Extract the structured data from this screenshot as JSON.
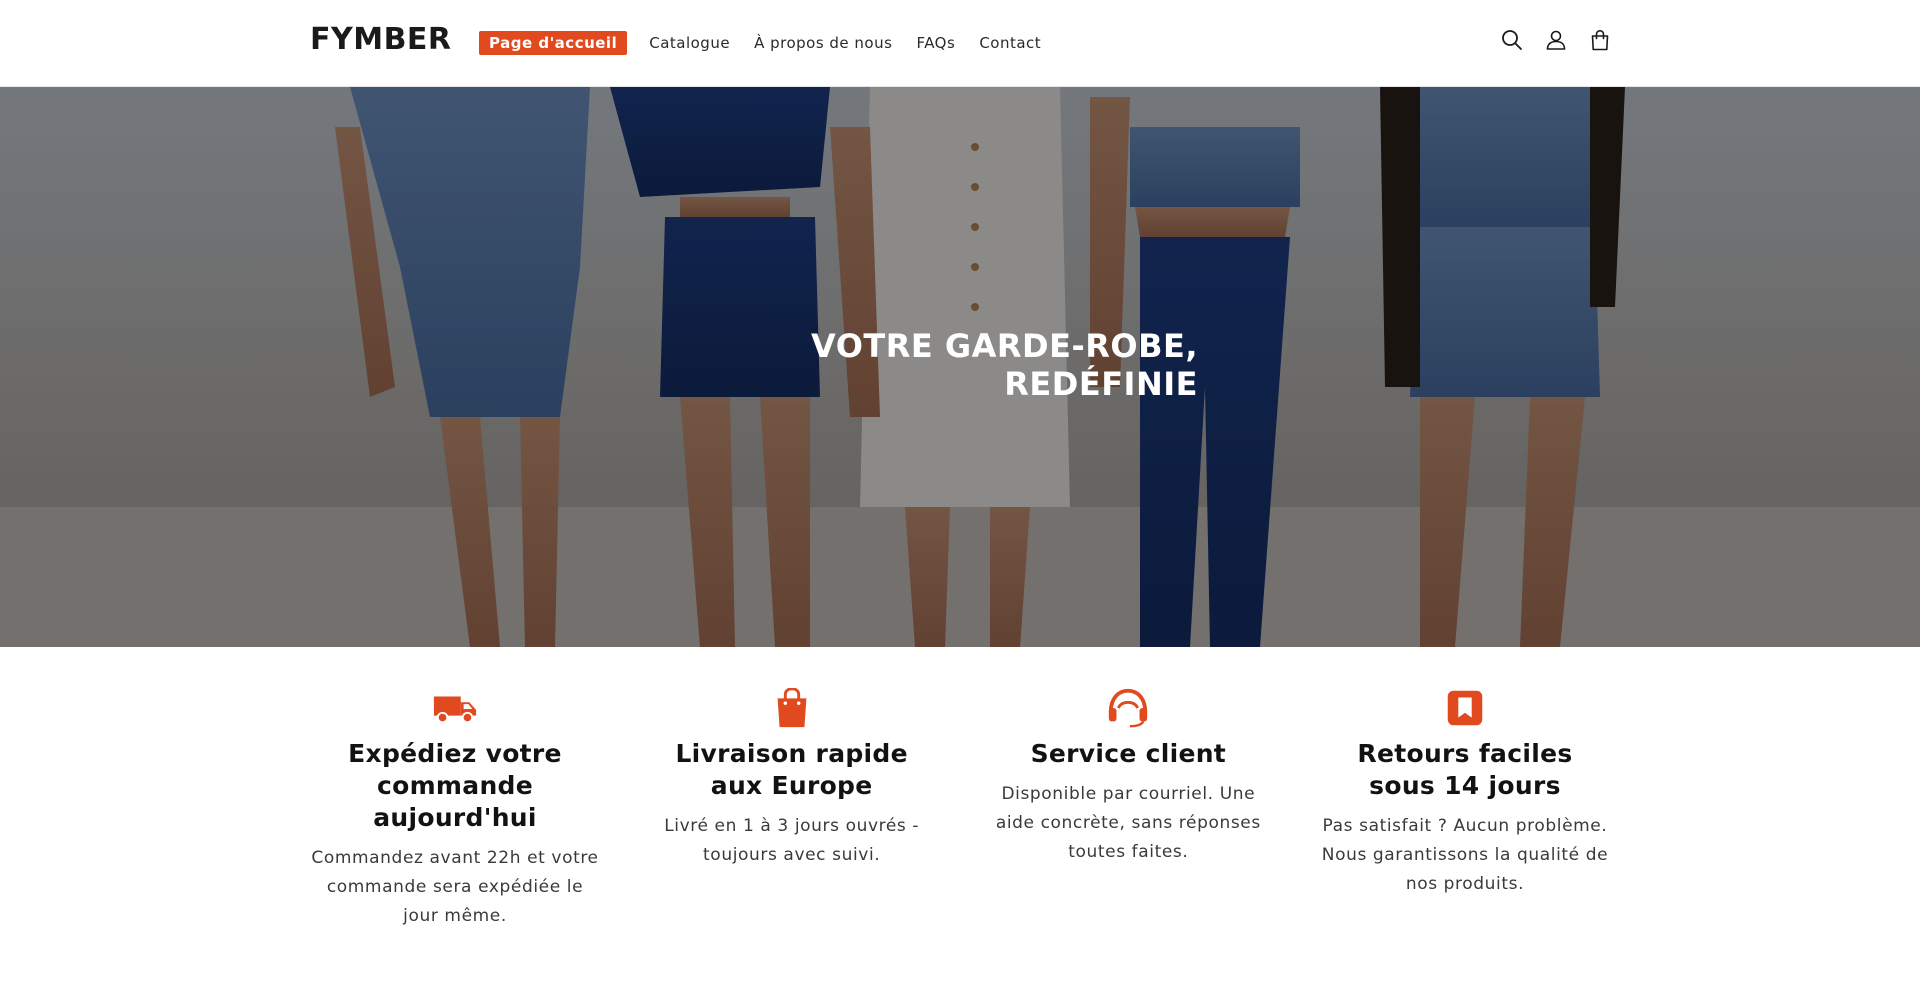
{
  "header": {
    "logo": "FYMBER",
    "nav": [
      {
        "label": "Page d'accueil",
        "active": true
      },
      {
        "label": "Catalogue",
        "active": false
      },
      {
        "label": "À propos de nous",
        "active": false
      },
      {
        "label": "FAQs",
        "active": false
      },
      {
        "label": "Contact",
        "active": false
      }
    ],
    "icons": [
      "search-icon",
      "account-icon",
      "cart-icon"
    ]
  },
  "hero": {
    "title": "VOTRE GARDE-ROBE, REDÉFINIE"
  },
  "features": [
    {
      "icon": "truck-icon",
      "title": "Expédiez votre commande aujourd'hui",
      "text": "Commandez avant 22h et votre commande sera expédiée le jour même."
    },
    {
      "icon": "shopping-bag-icon",
      "title": "Livraison rapide aux Europe",
      "text": "Livré en 1 à 3 jours ouvrés - toujours avec suivi."
    },
    {
      "icon": "headset-icon",
      "title": "Service client",
      "text": "Disponible par courriel. Une aide concrète, sans réponses toutes faites."
    },
    {
      "icon": "bookmark-icon",
      "title": "Retours faciles sous 14 jours",
      "text": "Pas satisfait ? Aucun problème.\nNous garantissons la qualité de nos produits."
    }
  ],
  "colors": {
    "accent": "#e14a1f",
    "text": "#121212",
    "background": "#ffffff"
  }
}
